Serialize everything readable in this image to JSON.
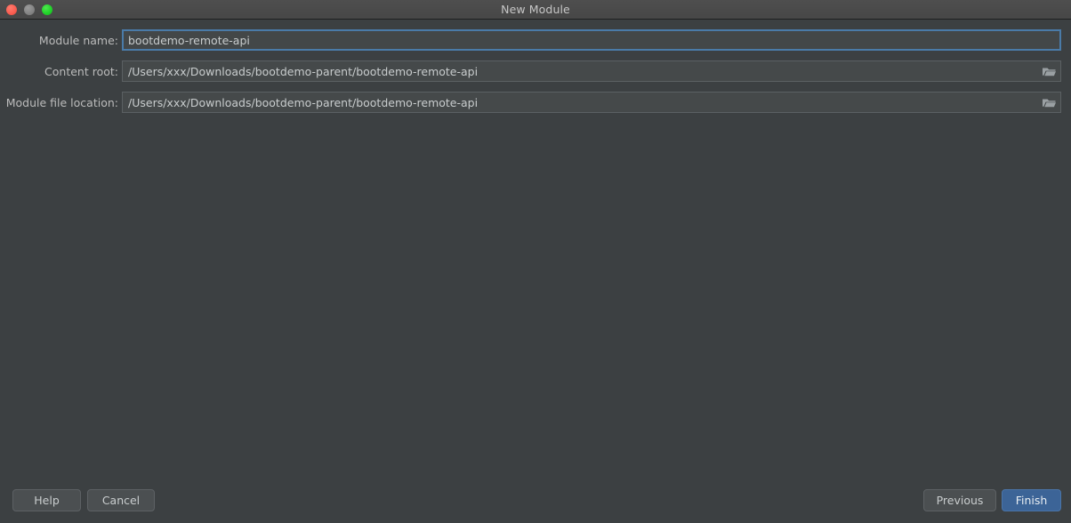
{
  "window": {
    "title": "New Module",
    "traffic_lights": [
      {
        "name": "close",
        "color": "#fb5f52"
      },
      {
        "name": "minimize",
        "color": "#858585"
      },
      {
        "name": "zoom",
        "color": "#22d32a"
      }
    ]
  },
  "form": {
    "rows": [
      {
        "label": "Module name:",
        "value": "bootdemo-remote-api",
        "placeholder": "",
        "focused": true,
        "has_browse": false
      },
      {
        "label": "Content root:",
        "value": "/Users/xxx/Downloads/bootdemo-parent/bootdemo-remote-api",
        "placeholder": "",
        "focused": false,
        "has_browse": true,
        "browse_icon": "folder-icon"
      },
      {
        "label": "Module file location:",
        "value": "/Users/xxx/Downloads/bootdemo-parent/bootdemo-remote-api",
        "placeholder": "",
        "focused": false,
        "has_browse": true,
        "browse_icon": "folder-icon"
      }
    ]
  },
  "footer": {
    "help_label": "Help",
    "cancel_label": "Cancel",
    "previous_label": "Previous",
    "finish_label": "Finish"
  },
  "colors": {
    "background": "#3c4042",
    "titlebar": "#4a4a4a",
    "field_background": "#45494a",
    "focus_border": "#4a7ba8",
    "accent_primary": "#3c6497",
    "text": "#bbbbbb"
  }
}
